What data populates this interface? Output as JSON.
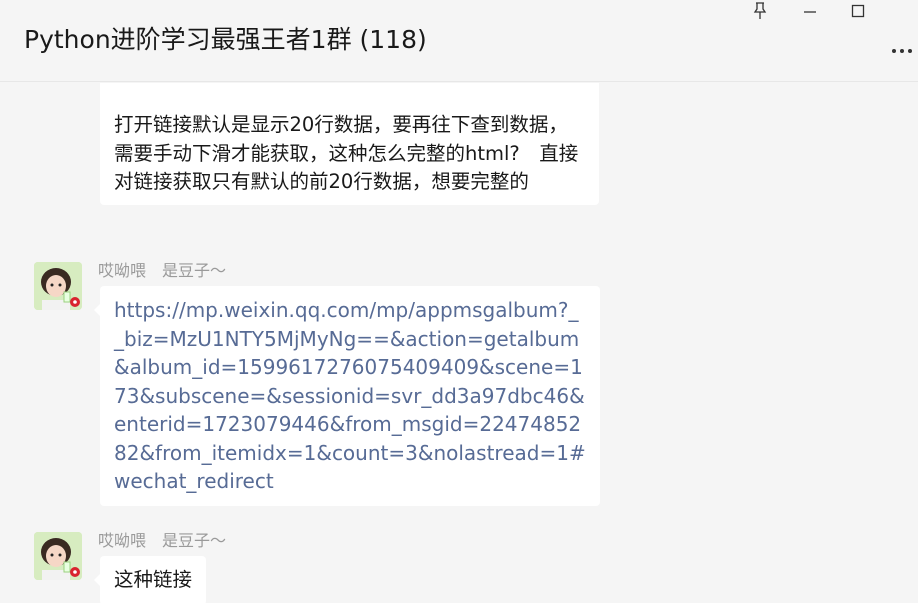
{
  "header": {
    "title": "Python进阶学习最强王者1群 (118)",
    "pin_icon": "pin-icon",
    "minimize_icon": "minimize-icon",
    "maximize_icon": "maximize-icon",
    "more_icon": "more-icon"
  },
  "messages": [
    {
      "text": "打开链接默认是显示20行数据，要再往下查到数据，需要手动下滑才能获取，这种怎么完整的html?　直接对链接获取只有默认的前20行数据，想要完整的"
    },
    {
      "sender": "哎呦喂　是豆子～",
      "text": "https://mp.weixin.qq.com/mp/appmsgalbum?__biz=MzU1NTY5MjMyNg==&action=getalbum&album_id=1599617276075409409&scene=173&subscene=&sessionid=svr_dd3a97dbc46&enterid=1723079446&from_msgid=2247485282&from_itemidx=1&count=3&nolastread=1#wechat_redirect"
    },
    {
      "sender": "哎呦喂　是豆子～",
      "text": "这种链接"
    }
  ]
}
